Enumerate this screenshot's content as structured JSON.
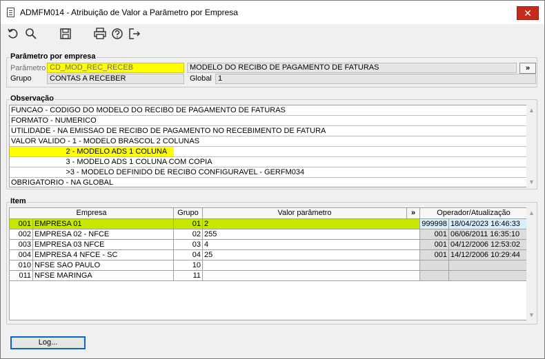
{
  "window": {
    "title": "ADMFM014 - Atribuição de Valor a Parâmetro por Empresa",
    "close_label": "✕"
  },
  "toolbar": {
    "icons": [
      "undo-icon",
      "search-icon",
      "save-icon",
      "print-icon",
      "help-icon",
      "exit-icon"
    ]
  },
  "param": {
    "group_label": "Parâmetro por empresa",
    "parametro_label": "Parâmetro",
    "parametro_value": "CD_MOD_REC_RECEB",
    "parametro_desc": "MODELO DO RECIBO DE PAGAMENTO DE FATURAS",
    "more_label": "»",
    "grupo_label": "Grupo",
    "grupo_value": "CONTAS A RECEBER",
    "global_label": "Global",
    "global_value": "1"
  },
  "observacao": {
    "group_label": "Observação",
    "lines": [
      "FUNCAO - CODIGO DO MODELO DO RECIBO DE PAGAMENTO DE FATURAS",
      "FORMATO - NUMERICO",
      "UTILIDADE - NA EMISSAO DE RECIBO DE PAGAMENTO NO RECEBIMENTO DE FATURA",
      "VALOR VALIDO - 1 - MODELO BRASCOL 2 COLUNAS",
      "                          2 - MODELO ADS 1 COLUNA",
      "                          3 - MODELO ADS 1 COLUNA COM COPIA",
      "                          >3 - MODELO DEFINIDO DE RECIBO CONFIGURAVEL - GERFM034",
      "OBRIGATORIO - NA GLOBAL"
    ]
  },
  "item": {
    "group_label": "Item",
    "columns": {
      "empresa": "Empresa",
      "grupo": "Grupo",
      "valor": "Valor parâmetro",
      "more": "»",
      "operador": "Operador/Atualização"
    },
    "rows": [
      {
        "cod": "001",
        "empresa": "EMPRESA 01",
        "grupo": "01",
        "valor": "2",
        "operador": "999998",
        "data": "18/04/2023 16:46:33"
      },
      {
        "cod": "002",
        "empresa": "EMPRESA 02 - NFCE",
        "grupo": "02",
        "valor": "255",
        "operador": "001",
        "data": "06/06/2011 16:35:10"
      },
      {
        "cod": "003",
        "empresa": "EMPRESA 03 NFCE",
        "grupo": "03",
        "valor": "4",
        "operador": "001",
        "data": "04/12/2006 12:53:02"
      },
      {
        "cod": "004",
        "empresa": "EMPRESA 4 NFCE - SC",
        "grupo": "04",
        "valor": "25",
        "operador": "001",
        "data": "14/12/2006 10:29:44"
      },
      {
        "cod": "010",
        "empresa": "NFSE SAO PAULO",
        "grupo": "10",
        "valor": "",
        "operador": "",
        "data": ""
      },
      {
        "cod": "011",
        "empresa": "NFSE MARINGA",
        "grupo": "11",
        "valor": "",
        "operador": "",
        "data": ""
      }
    ]
  },
  "footer": {
    "log_label": "Log..."
  },
  "colors": {
    "highlight": "#ffff00",
    "row_selected": "#c8e600",
    "close": "#c42b1c",
    "focus": "#0a64c8"
  }
}
